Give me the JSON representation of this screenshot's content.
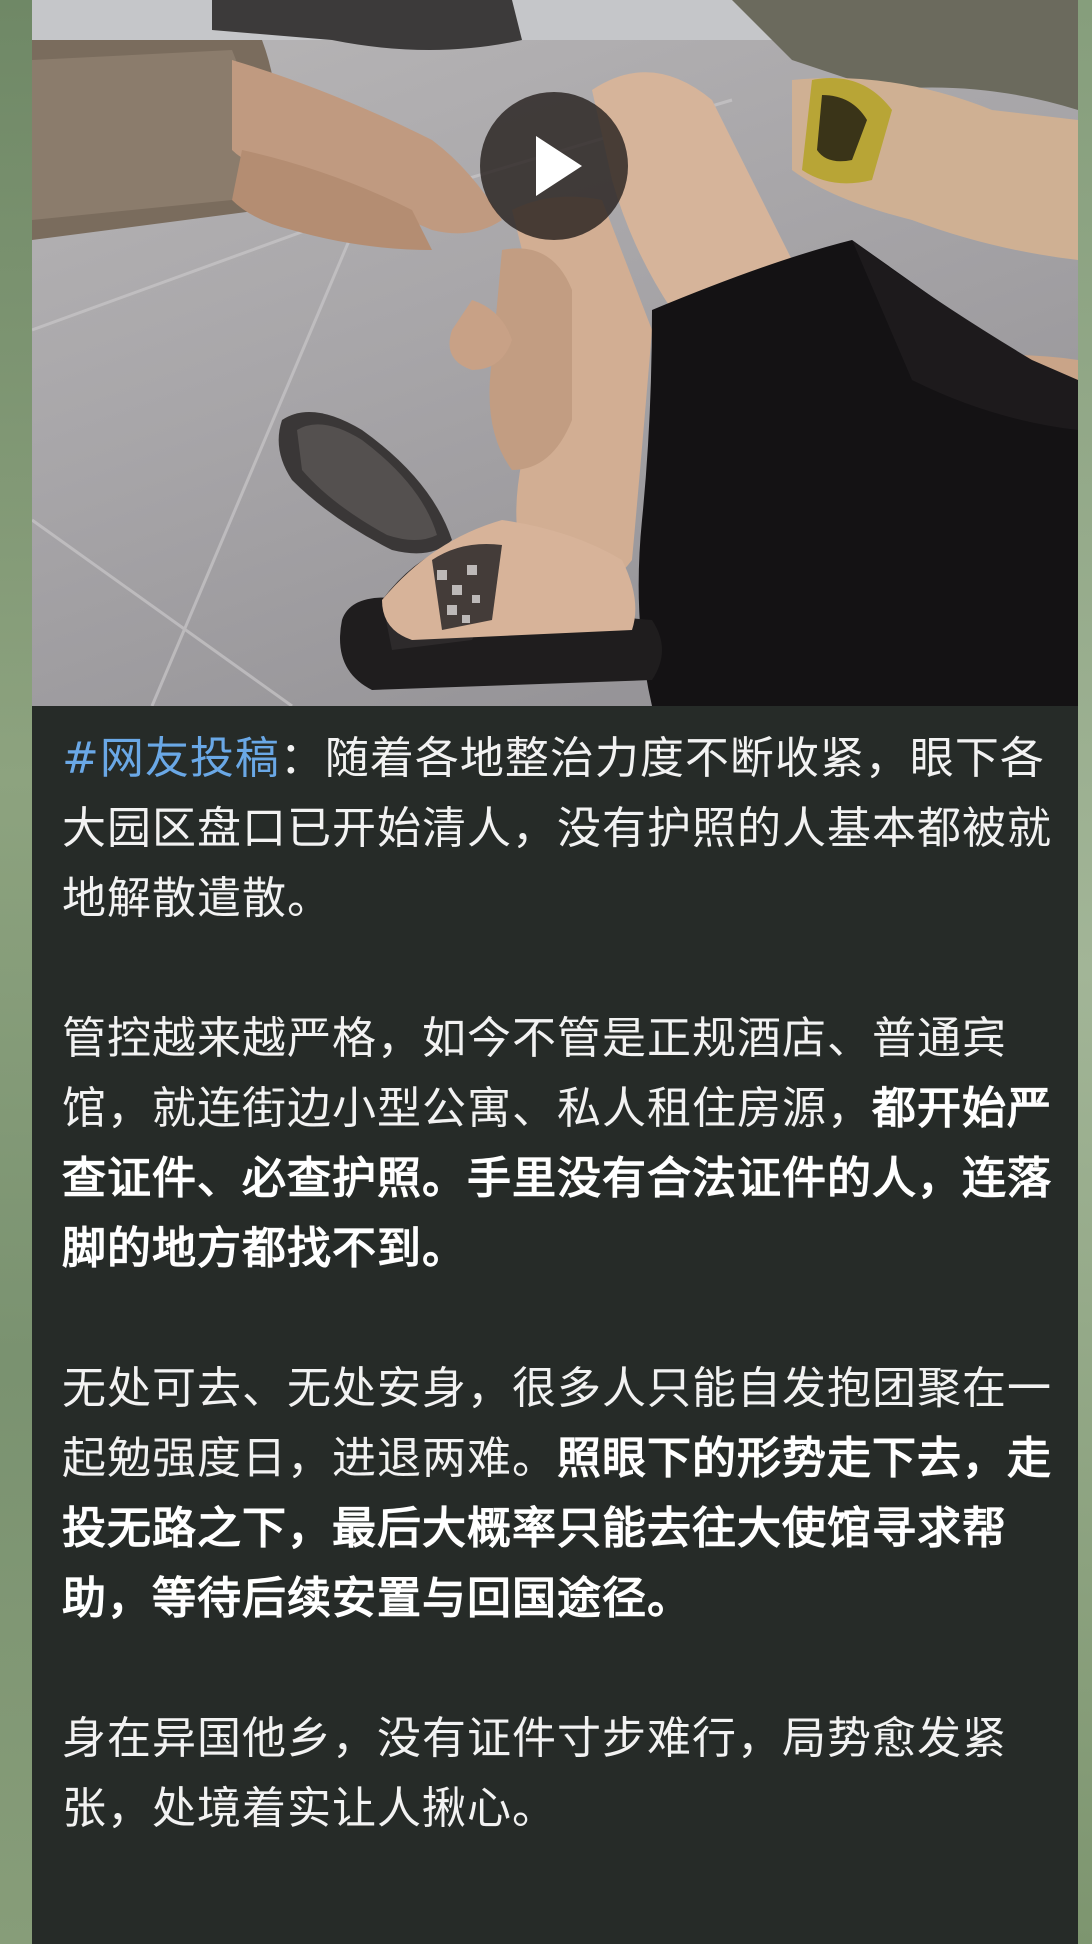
{
  "video": {
    "thumbnail_icon": "video-thumbnail-image",
    "play_icon": "play-icon"
  },
  "post": {
    "hashtag": "#网友投稿",
    "p1_rest": "：随着各地整治力度不断收紧，眼下各大园区盘口已开始清人，没有护照的人基本都被就地解散遣散。",
    "p2_normal": "管控越来越严格，如今不管是正规酒店、普通宾馆，就连街边小型公寓、私人租住房源，",
    "p2_bold": "都开始严查证件、必查护照。手里没有合法证件的人，连落脚的地方都找不到。",
    "p3_normal": "无处可去、无处安身，很多人只能自发抱团聚在一起勉强度日，进退两难。",
    "p3_bold": "照眼下的形势走下去，走投无路之下，最后大概率只能去往大使馆寻求帮助，等待后续安置与回国途径。",
    "p4": "身在异国他乡，没有证件寸步难行，局势愈发紧张，处境着实让人揪心。"
  },
  "colors": {
    "bubble_bg": "#262b28",
    "hashtag": "#6aa8e6",
    "text": "#f2f2f2",
    "chat_bg": "#7f9775"
  }
}
